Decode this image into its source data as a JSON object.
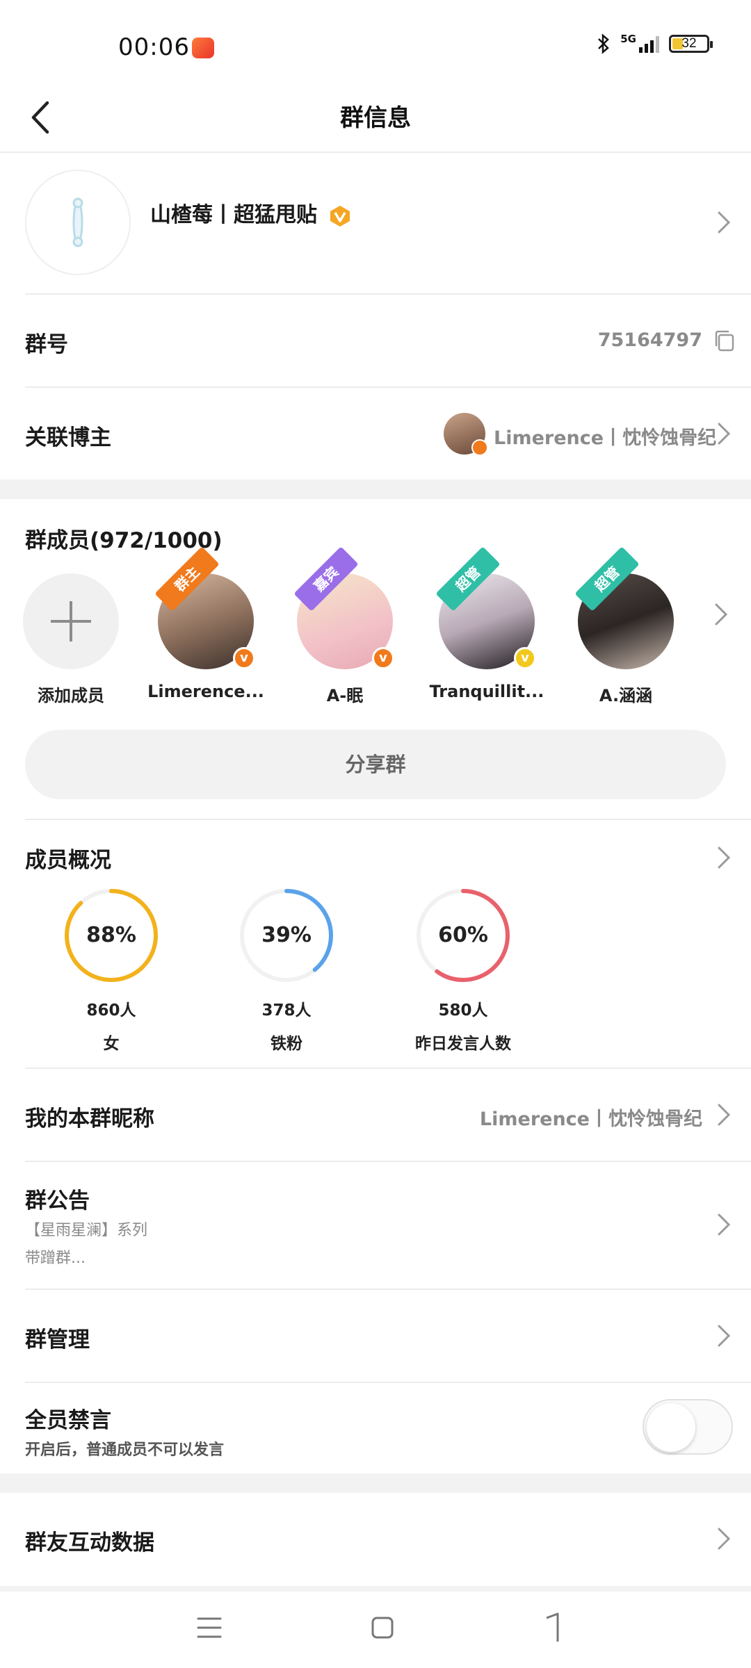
{
  "status_bar": {
    "time": "00:06",
    "network": "5G",
    "battery": "32",
    "battery_level": 0.32
  },
  "nav": {
    "title": "群信息"
  },
  "group": {
    "name": "山楂莓丨超猛甩贴"
  },
  "group_id": {
    "label": "群号",
    "value": "75164797"
  },
  "linked_blogger": {
    "label": "关联博主",
    "value": "Limerence丨忱怜蚀骨纪"
  },
  "members": {
    "title": "群成员(972/1000)",
    "add_label": "添加成员",
    "list": [
      {
        "name": "Limerence...",
        "role": "群主",
        "role_color": "#f07a1c",
        "badge_color": "#f07a1c"
      },
      {
        "name": "A-眠",
        "role": "嘉宾",
        "role_color": "#9a6ee8",
        "badge_color": "#f07a1c"
      },
      {
        "name": "Tranquillit...",
        "role": "超管",
        "role_color": "#2fbfa6",
        "badge_color": "#f2c81c"
      },
      {
        "name": "A.涵涵",
        "role": "超管",
        "role_color": "#2fbfa6",
        "badge_color": ""
      }
    ],
    "share_label": "分享群"
  },
  "overview": {
    "title": "成员概况",
    "stats": [
      {
        "percent": "88%",
        "value": 0.88,
        "count": "860人",
        "label": "女",
        "color": "#f2b21c"
      },
      {
        "percent": "39%",
        "value": 0.39,
        "count": "378人",
        "label": "铁粉",
        "color": "#5aa2ea"
      },
      {
        "percent": "60%",
        "value": 0.6,
        "count": "580人",
        "label": "昨日发言人数",
        "color": "#e8616c"
      }
    ]
  },
  "nickname": {
    "label": "我的本群昵称",
    "value": "Limerence丨忱怜蚀骨纪"
  },
  "announcement": {
    "label": "群公告",
    "line1": "【星雨星澜】系列",
    "line2": "带蹭群..."
  },
  "management": {
    "label": "群管理"
  },
  "mute_all": {
    "label": "全员禁言",
    "desc": "开启后，普通成员不可以发言",
    "enabled": false
  },
  "interaction": {
    "label": "群友互动数据"
  },
  "icons": [
    "back-icon",
    "chevron-right-icon",
    "copy-icon",
    "vip-icon",
    "plus-icon",
    "menu-icon",
    "home-icon",
    "back-gesture-icon",
    "bluetooth-icon",
    "signal-icon",
    "battery-icon"
  ]
}
